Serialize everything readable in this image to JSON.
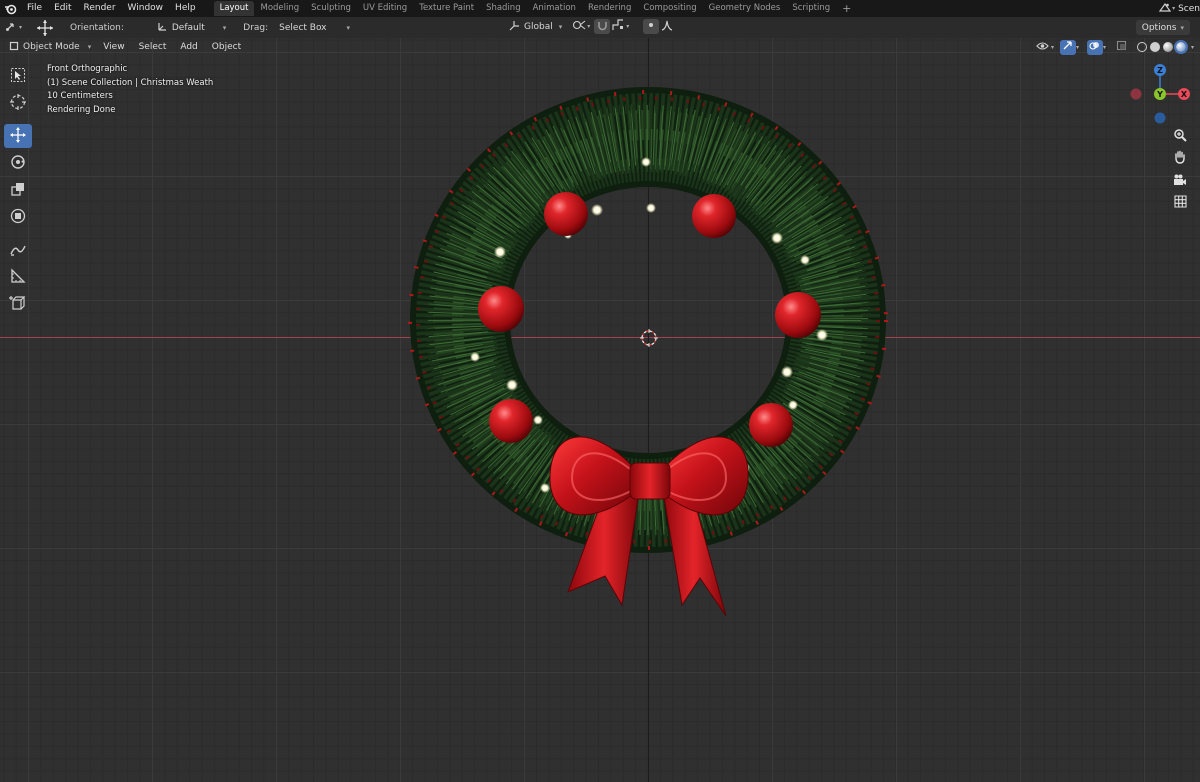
{
  "app": {
    "menu": [
      "File",
      "Edit",
      "Render",
      "Window",
      "Help"
    ],
    "workspaces": [
      "Layout",
      "Modeling",
      "Sculpting",
      "UV Editing",
      "Texture Paint",
      "Shading",
      "Animation",
      "Rendering",
      "Compositing",
      "Geometry Nodes",
      "Scripting"
    ],
    "active_workspace": "Layout",
    "add_workspace": "+",
    "scene_label": "Scen"
  },
  "tool_header": {
    "orientation_label": "Orientation:",
    "orientation_value": "Default",
    "drag_label": "Drag:",
    "drag_value": "Select Box",
    "transform_orientation": "Global",
    "options_label": "Options"
  },
  "viewport_header": {
    "mode": "Object Mode",
    "menus": [
      "View",
      "Select",
      "Add",
      "Object"
    ]
  },
  "overlay": {
    "view_name": "Front Orthographic",
    "collection": "(1) Scene Collection | Christmas Weath",
    "scale": "10 Centimeters",
    "status": "Rendering Done"
  },
  "gizmo": {
    "z_label": "Z",
    "x_label": "X",
    "y_label": "Y"
  },
  "colors": {
    "accent": "#4772b3",
    "axis_x": "#e94a59",
    "axis_y": "#8ac62a",
    "axis_z": "#3a7fd6",
    "ornament": "#c8141a",
    "bow": "#d1161b",
    "pine": "#1e3a1c"
  },
  "icons": {
    "tools": [
      "select-box-icon",
      "cursor-icon",
      "move-icon",
      "rotate-icon",
      "scale-icon",
      "transform-icon",
      "annotate-icon",
      "measure-icon",
      "add-cube-icon"
    ],
    "nav": [
      "zoom-icon",
      "pan-hand-icon",
      "camera-icon",
      "grid-icon"
    ]
  }
}
